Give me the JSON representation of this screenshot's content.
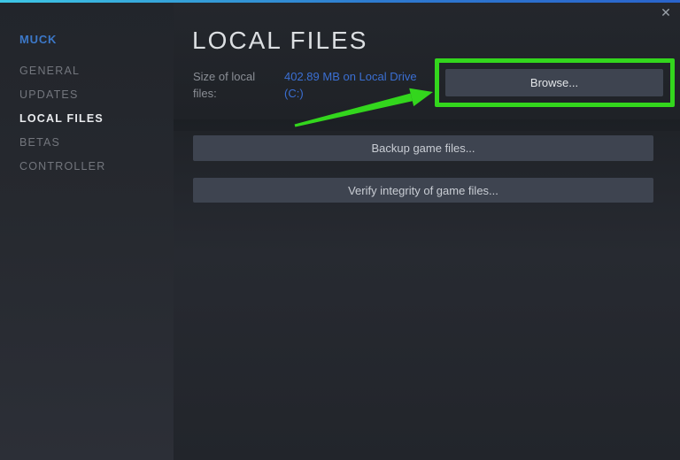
{
  "window": {
    "close_icon": "✕"
  },
  "sidebar": {
    "game_title": "MUCK",
    "selected": "LOCAL FILES",
    "items": [
      {
        "label": "GENERAL"
      },
      {
        "label": "UPDATES"
      },
      {
        "label": "LOCAL FILES"
      },
      {
        "label": "BETAS"
      },
      {
        "label": "CONTROLLER"
      }
    ]
  },
  "main": {
    "title": "LOCAL FILES",
    "size_row": {
      "label": "Size of local files:",
      "value": "402.89 MB on Local Drive (C:)"
    },
    "buttons": {
      "browse": "Browse...",
      "backup": "Backup game files...",
      "verify": "Verify integrity of game files..."
    }
  },
  "annotation": {
    "highlight_color": "#33d61d",
    "arrow_color": "#33d61d"
  },
  "colors": {
    "link_blue": "#3b6fd2",
    "sidebar_game_blue": "#3c78c8",
    "top_gradient_left": "#3ec7e6",
    "top_gradient_right": "#2a64cc",
    "button_bg": "#3e4450"
  }
}
